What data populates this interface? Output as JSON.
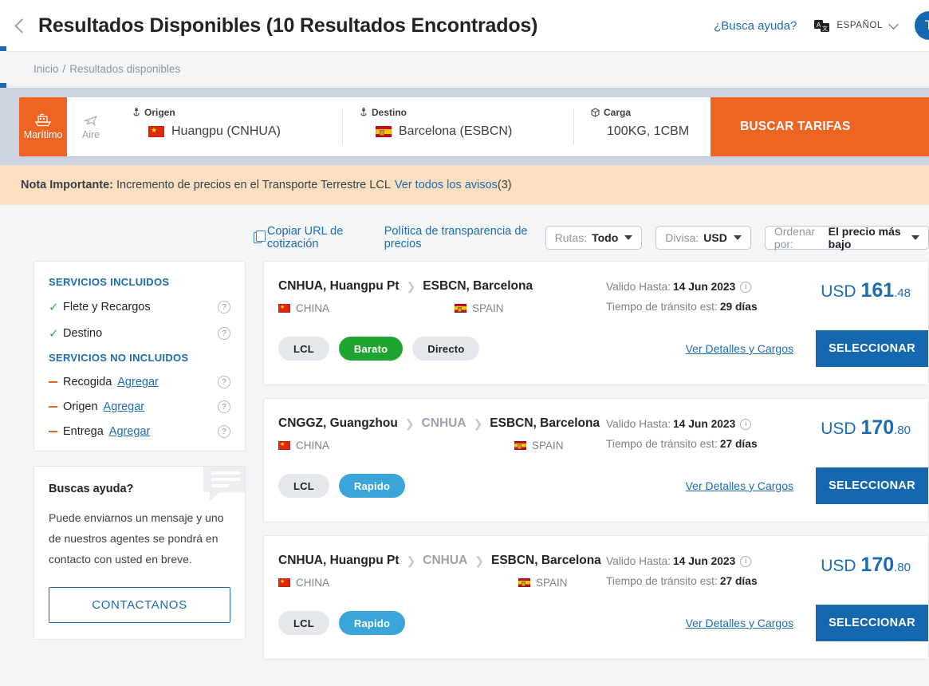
{
  "header": {
    "back_icon": "chevron-left-icon",
    "title": "Resultados Disponibles (10 Resultados Encontrados)",
    "help_link": "¿Busca ayuda?",
    "language_icon": "translate-icon",
    "language": "ESPAÑOL",
    "avatar_initial": "T"
  },
  "breadcrumb": {
    "home": "Inicio",
    "separator": "/",
    "current": "Resultados disponibles"
  },
  "searchbar": {
    "modes": [
      {
        "label": "Marítimo",
        "icon": "ship-icon",
        "active": true
      },
      {
        "label": "Aire",
        "icon": "plane-icon",
        "active": false
      }
    ],
    "origin": {
      "label": "Origen",
      "icon": "anchor-icon",
      "flag": "flag-cn",
      "value": "Huangpu (CNHUA)"
    },
    "destination": {
      "label": "Destino",
      "icon": "anchor-icon",
      "flag": "flag-es",
      "value": "Barcelona (ESBCN)"
    },
    "cargo": {
      "label": "Carga",
      "icon": "box-icon",
      "value": "100KG, 1CBM"
    },
    "cta": "BUSCAR TARIFAS"
  },
  "notice": {
    "title": "Nota Importante:",
    "text": "Incremento de precios en el Transporte Terrestre LCL",
    "link": "Ver todos los avisos",
    "count": "(3)"
  },
  "toolbar": {
    "copy_icon": "copy-icon",
    "copy_label": "Copiar URL de cotización",
    "policy_label": "Política de transparencia de precios",
    "filters": [
      {
        "label": "Rutas:",
        "value": "Todo"
      },
      {
        "label": "Divisa:",
        "value": "USD"
      },
      {
        "label": "Ordenar por:",
        "value": "El precio más bajo"
      }
    ]
  },
  "sidebar": {
    "included_title": "SERVICIOS INCLUIDOS",
    "included": [
      {
        "name": "Flete y Recargos",
        "help": "?"
      },
      {
        "name": "Destino",
        "help": "?"
      }
    ],
    "excluded_title": "SERVICIOS NO INCLUIDOS",
    "excluded": [
      {
        "name": "Recogida",
        "add": "Agregar",
        "help": "?"
      },
      {
        "name": "Origen",
        "add": "Agregar",
        "help": "?"
      },
      {
        "name": "Entrega",
        "add": "Agregar",
        "help": "?"
      }
    ],
    "help_box": {
      "title": "Buscas ayuda?",
      "text": "Puede enviarnos un mensaje y uno de nuestros agentes se pondrá en contacto con usted en breve.",
      "button": "CONTACTANOS",
      "icon": "chat-bubble-icon"
    }
  },
  "results": [
    {
      "route": [
        {
          "text": "CNHUA, Huangpu Pt",
          "muted": false
        },
        {
          "text": "ESBCN, Barcelona",
          "muted": false
        }
      ],
      "origin_country": "CHINA",
      "origin_flag": "flag-cn",
      "dest_country": "SPAIN",
      "dest_flag": "flag-es",
      "valid_label": "Valido Hasta:",
      "valid_value": "14 Jun 2023",
      "transit_label": "Tiempo de tránsito est:",
      "transit_value": "29 días",
      "currency": "USD",
      "price_int": "161",
      "price_dec": ".48",
      "tags": [
        {
          "text": "LCL",
          "style": "grey"
        },
        {
          "text": "Barato",
          "style": "green"
        },
        {
          "text": "Directo",
          "style": "grey"
        }
      ],
      "details_link": "Ver Detalles y Cargos",
      "select_button": "SELECCIONAR"
    },
    {
      "route": [
        {
          "text": "CNGGZ, Guangzhou",
          "muted": false
        },
        {
          "text": "CNHUA",
          "muted": true
        },
        {
          "text": "ESBCN, Barcelona",
          "muted": false
        }
      ],
      "origin_country": "CHINA",
      "origin_flag": "flag-cn",
      "dest_country": "SPAIN",
      "dest_flag": "flag-es",
      "valid_label": "Valido Hasta:",
      "valid_value": "14 Jun 2023",
      "transit_label": "Tiempo de tránsito est:",
      "transit_value": "27 días",
      "currency": "USD",
      "price_int": "170",
      "price_dec": ".80",
      "tags": [
        {
          "text": "LCL",
          "style": "grey"
        },
        {
          "text": "Rapido",
          "style": "blue"
        }
      ],
      "details_link": "Ver Detalles y Cargos",
      "select_button": "SELECCIONAR"
    },
    {
      "route": [
        {
          "text": "CNHUA, Huangpu Pt",
          "muted": false
        },
        {
          "text": "CNHUA",
          "muted": true
        },
        {
          "text": "ESBCN, Barcelona",
          "muted": false
        }
      ],
      "origin_country": "CHINA",
      "origin_flag": "flag-cn",
      "dest_country": "SPAIN",
      "dest_flag": "flag-es",
      "valid_label": "Valido Hasta:",
      "valid_value": "14 Jun 2023",
      "transit_label": "Tiempo de tránsito est:",
      "transit_value": "27 días",
      "currency": "USD",
      "price_int": "170",
      "price_dec": ".80",
      "tags": [
        {
          "text": "LCL",
          "style": "grey"
        },
        {
          "text": "Rapido",
          "style": "blue"
        }
      ],
      "details_link": "Ver Detalles y Cargos",
      "select_button": "SELECCIONAR"
    }
  ],
  "colors": {
    "accent_orange": "#ee6423",
    "accent_blue": "#1568b0",
    "link_blue": "#1b6cb0",
    "notice_bg": "#fadfc0",
    "tag_green": "#1fa331",
    "tag_blue": "#3aa5d8"
  }
}
